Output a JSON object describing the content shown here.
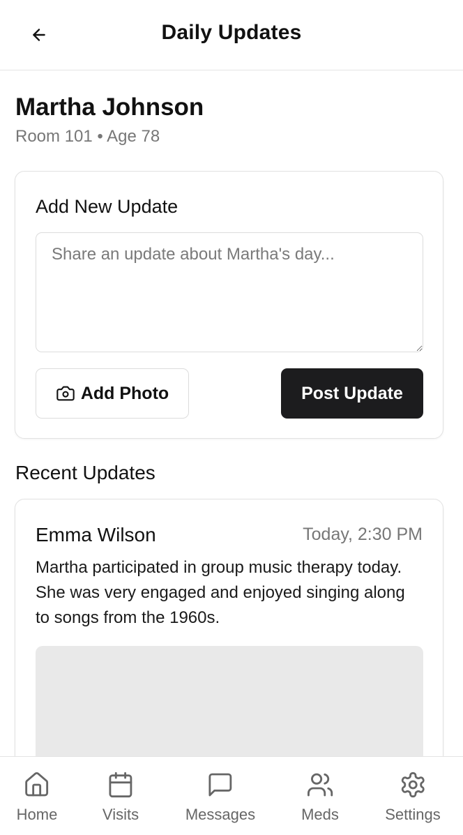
{
  "header": {
    "title": "Daily Updates",
    "back_icon": "arrow-left-icon"
  },
  "resident": {
    "name": "Martha Johnson",
    "meta": "Room 101 • Age 78"
  },
  "add_update": {
    "title": "Add New Update",
    "placeholder": "Share an update about Martha's day...",
    "value": "",
    "photo_button_label": "Add Photo",
    "photo_icon": "camera-icon",
    "post_button_label": "Post Update"
  },
  "recent": {
    "title": "Recent Updates",
    "items": [
      {
        "author": "Emma Wilson",
        "time": "Today, 2:30 PM",
        "text": "Martha participated in group music therapy today. She was very engaged and enjoyed singing along to songs from the 1960s."
      }
    ]
  },
  "nav": {
    "items": [
      {
        "label": "Home",
        "icon": "home-icon"
      },
      {
        "label": "Visits",
        "icon": "calendar-icon"
      },
      {
        "label": "Messages",
        "icon": "message-icon"
      },
      {
        "label": "Meds",
        "icon": "users-icon"
      },
      {
        "label": "Settings",
        "icon": "gear-icon"
      }
    ]
  }
}
